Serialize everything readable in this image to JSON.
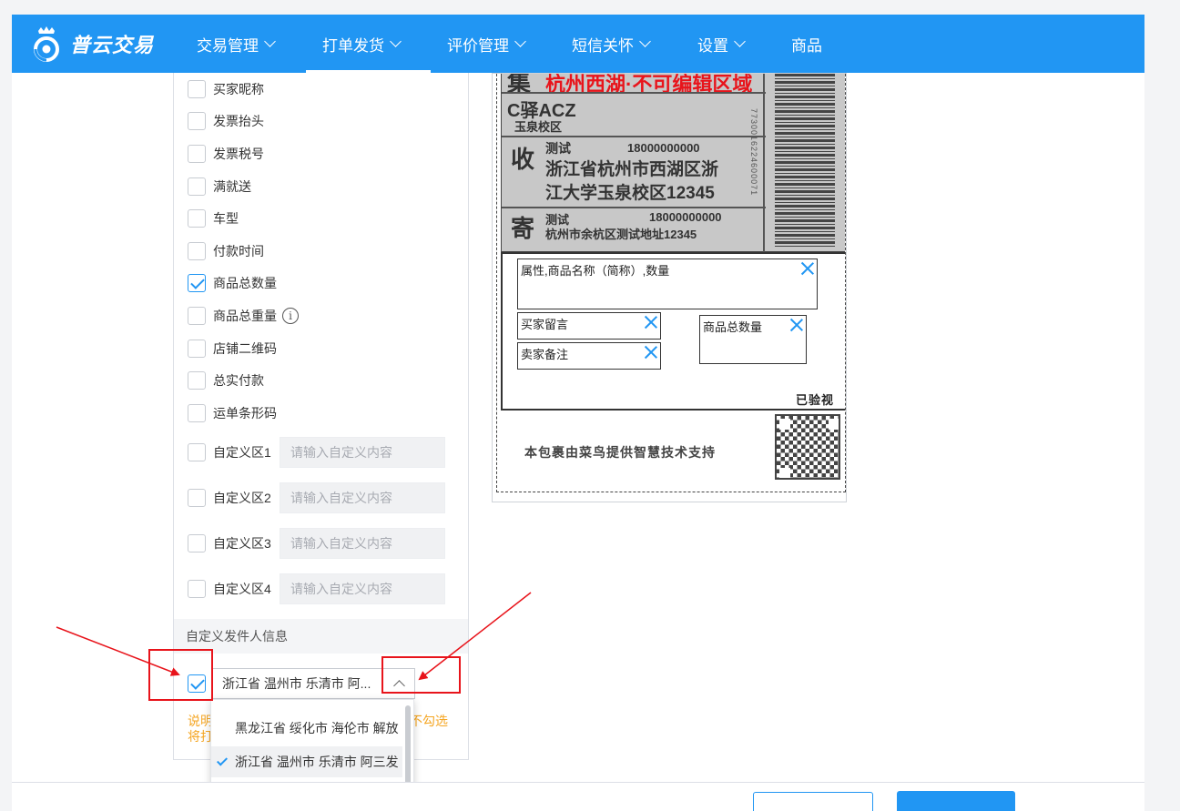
{
  "nav": {
    "brand": "普云交易",
    "items": [
      {
        "label": "交易管理"
      },
      {
        "label": "打单发货"
      },
      {
        "label": "评价管理"
      },
      {
        "label": "短信关怀"
      },
      {
        "label": "设置"
      },
      {
        "label": "商品"
      }
    ]
  },
  "fields": [
    {
      "label": "买家昵称",
      "checked": false
    },
    {
      "label": "发票抬头",
      "checked": false
    },
    {
      "label": "发票税号",
      "checked": false
    },
    {
      "label": "满就送",
      "checked": false
    },
    {
      "label": "车型",
      "checked": false
    },
    {
      "label": "付款时间",
      "checked": false
    },
    {
      "label": "商品总数量",
      "checked": true
    },
    {
      "label": "商品总重量",
      "checked": false
    },
    {
      "label": "店铺二维码",
      "checked": false
    },
    {
      "label": "总实付款",
      "checked": false
    },
    {
      "label": "运单条形码",
      "checked": false
    }
  ],
  "custom_areas": [
    {
      "label": "自定义区1",
      "placeholder": "请输入自定义内容"
    },
    {
      "label": "自定义区2",
      "placeholder": "请输入自定义内容"
    },
    {
      "label": "自定义区3",
      "placeholder": "请输入自定义内容"
    },
    {
      "label": "自定义区4",
      "placeholder": "请输入自定义内容"
    }
  ],
  "sender": {
    "section_title": "自定义发件人信息",
    "enabled": true,
    "selected": "浙江省 温州市 乐清市 阿...",
    "note_left": "说明",
    "note_left2": "将打",
    "note_right": "不勾选",
    "options": [
      {
        "label": "黑龙江省 绥化市 海伦市 解放",
        "selected": false
      },
      {
        "label": "浙江省 温州市 乐清市 阿三发",
        "selected": true
      }
    ]
  },
  "waybill": {
    "top_char": "集",
    "top_text": "杭州西湖·不可编辑区域",
    "station": "C驿ACZ",
    "station_sub": "玉泉校区",
    "receiver_mark": "收",
    "receiver_name": "测试",
    "receiver_phone": "18000000000",
    "receiver_addr1": "浙江省杭州市西湖区浙",
    "receiver_addr2": "江大学玉泉校区12345",
    "sender_mark": "寄",
    "sender_name": "测试",
    "sender_phone": "18000000000",
    "sender_addr": "杭州市余杭区测试地址12345",
    "barcode_digits": "7730016224600071",
    "box_items": "属性,商品名称（简称）,数量",
    "box_buyer_msg": "买家留言",
    "box_seller_note": "卖家备注",
    "box_total_qty": "商品总数量",
    "inspected": "已验视",
    "footer": "本包裹由菜鸟提供智慧技术支持"
  },
  "colors": {
    "primary": "#2196f3",
    "annotation": "#e8141b",
    "note": "#f5a623"
  }
}
